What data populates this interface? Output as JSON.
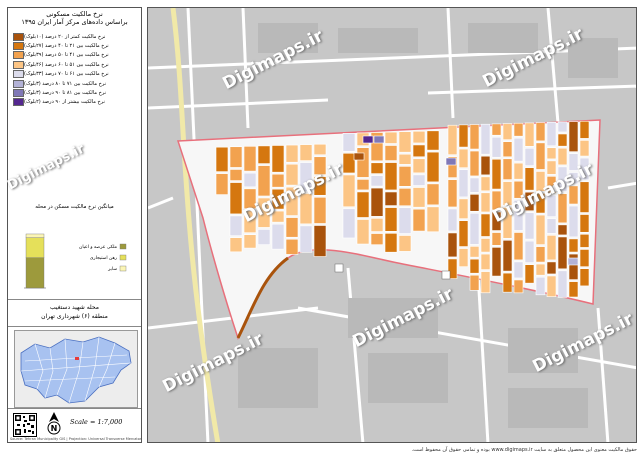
{
  "panel": {
    "title_line1": "نرخ مالکیت مسکونی",
    "title_line2": "براساس داده‌های مرکز آمار ایران ۱۳۹۵"
  },
  "legend": [
    {
      "label": "نرخ مالکیت کمتر از ۲۰ درصد (۱۰بلوک)",
      "color": "#a9530c"
    },
    {
      "label": "نرخ مالکیت بین ۲۱ تا ۴۰ درصد (۲۷بلوک)",
      "color": "#d5770f"
    },
    {
      "label": "نرخ مالکیت بین ۴۱ تا ۵۰ درصد (۳۹بلوک)",
      "color": "#f2a24f"
    },
    {
      "label": "نرخ مالکیت بین ۵۱ تا ۶۰ درصد (۴۶بلوک)",
      "color": "#fcc585"
    },
    {
      "label": "نرخ مالکیت بین ۶۱ تا ۷۰ درصد (۳۳بلوک)",
      "color": "#dcdcec"
    },
    {
      "label": "نرخ مالکیت بین ۷۱ تا ۸۰ درصد (۳بلوک)",
      "color": "#b3b2d6"
    },
    {
      "label": "نرخ مالکیت بین ۸۱ تا ۹۰ درصد (۳بلوک)",
      "color": "#8078b6"
    },
    {
      "label": "نرخ مالکیت بیشتر از ۹۰ درصد (۲بلوک)",
      "color": "#54278f"
    }
  ],
  "chart_data": {
    "type": "bar",
    "title": "میانگین نرخ مالکیت مسکن در محله",
    "categories": [
      ""
    ],
    "series": [
      {
        "name": "ملکی عرصه و اعیان",
        "color": "#9d9a3c",
        "values": [
          41
        ]
      },
      {
        "name": "رهن استیجاری",
        "color": "#e5e05a",
        "values": [
          27
        ]
      },
      {
        "name": "سایر",
        "color": "#fbf5b5",
        "values": [
          5
        ]
      }
    ],
    "ylim": [
      0,
      100
    ]
  },
  "info": {
    "neighborhood": "محله شهید دستغیب",
    "district": "منطقه (۶) شهرداری تهران"
  },
  "scale": "Scale = 1:7,000",
  "credit": "Source: Tehran Municipality GIS | Projection: Universal Transverse Mercator",
  "watermark": "Digimaps.ir",
  "copyright": "حقوق مالکیت معنوی این محصول متعلق به سایت www.digimaps.ir بوده و تمامی حقوق آن محفوظ است.",
  "colors": {
    "background_map": "#c7c7c7",
    "study_area_border": "#e8707c",
    "street": "#ffffff"
  }
}
